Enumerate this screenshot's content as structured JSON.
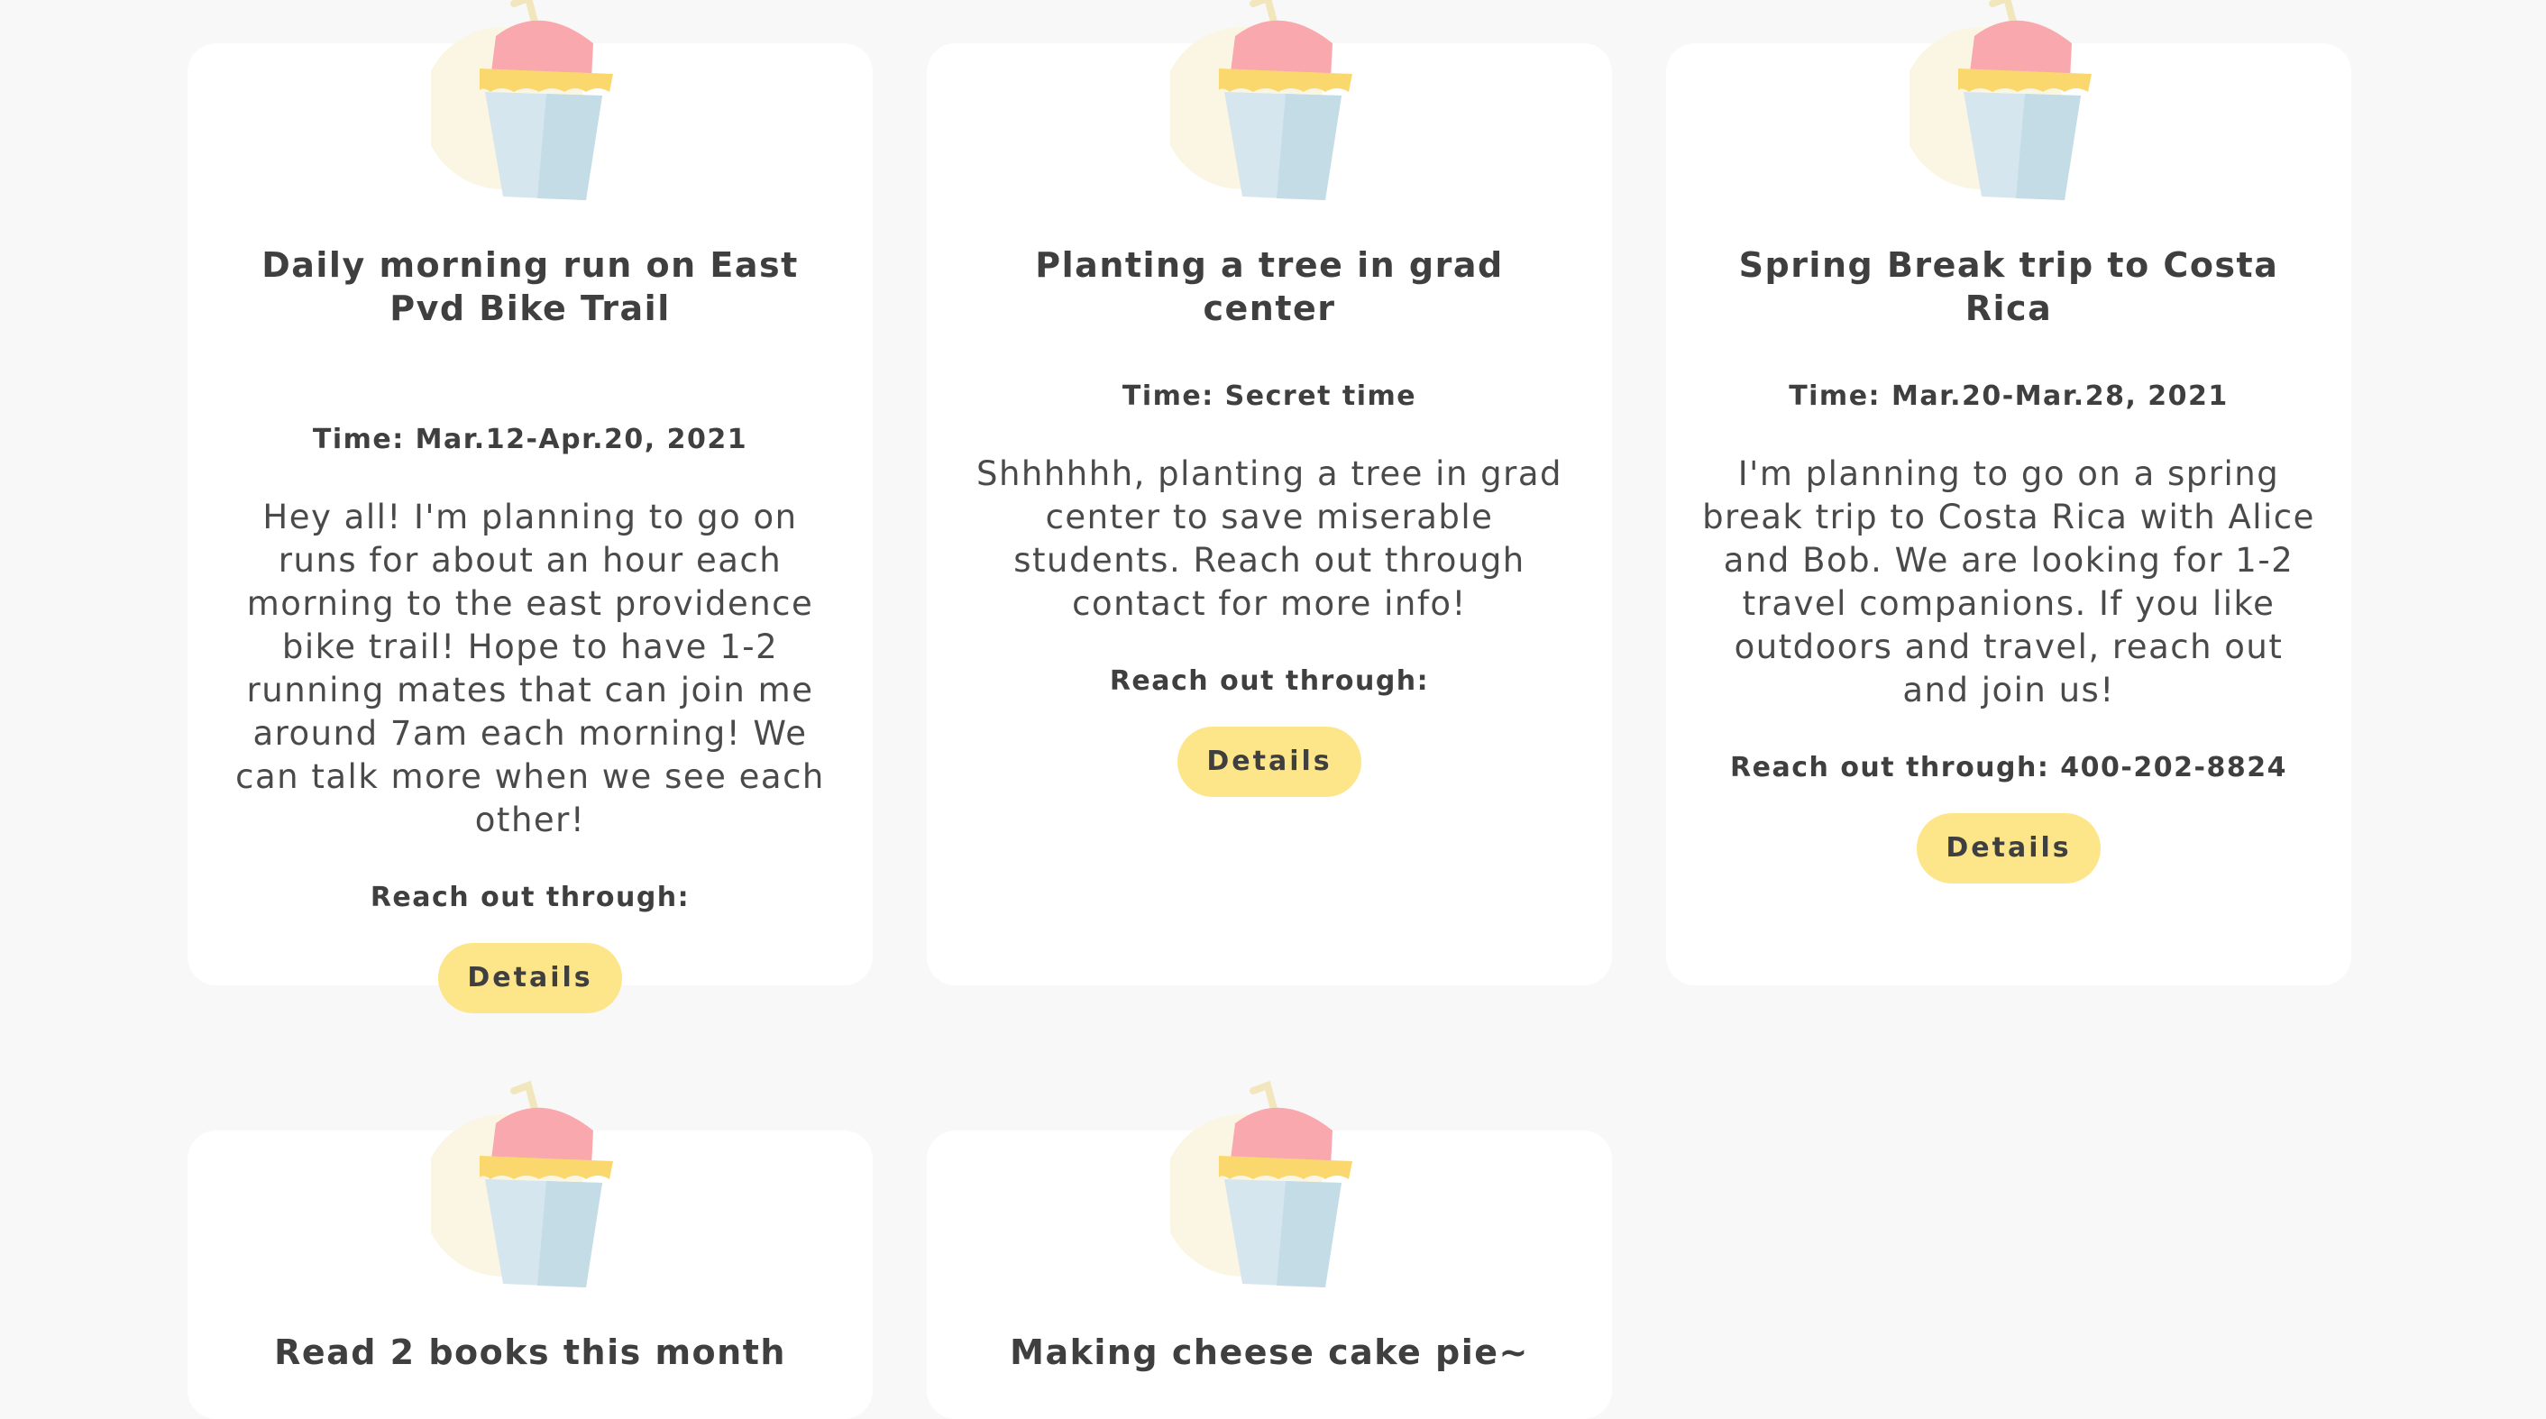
{
  "cards": [
    {
      "title": "Daily morning run on East Pvd Bike Trail",
      "time": "Time: Mar.12-Apr.20, 2021",
      "description": "Hey all! I'm planning to go on runs for about an hour each morning to the east providence bike trail! Hope to have 1-2 running mates that can join me around 7am each morning! We can talk more when we see each other!",
      "reach": "Reach out through:",
      "button": "Details"
    },
    {
      "title": "Planting a tree in grad center",
      "time": "Time: Secret time",
      "description": "Shhhhhh, planting a tree in grad center to save miserable students. Reach out through contact for more info!",
      "reach": "Reach out through:",
      "button": "Details"
    },
    {
      "title": "Spring Break trip to Costa Rica",
      "time": "Time: Mar.20-Mar.28, 2021",
      "description": "I'm planning to go on a spring break trip to Costa Rica with Alice and Bob. We are looking for 1-2 travel companions. If you like outdoors and travel, reach out and join us!",
      "reach": "Reach out through: 400-202-8824",
      "button": "Details"
    },
    {
      "title": "Read 2 books this month"
    },
    {
      "title": "Making cheese cake pie~"
    }
  ],
  "colors": {
    "background": "#f8f8f8",
    "card": "#ffffff",
    "button": "#fde68a",
    "text": "#3f3f3f"
  },
  "icons": {
    "mascot": "milkshake-cup-icon"
  }
}
